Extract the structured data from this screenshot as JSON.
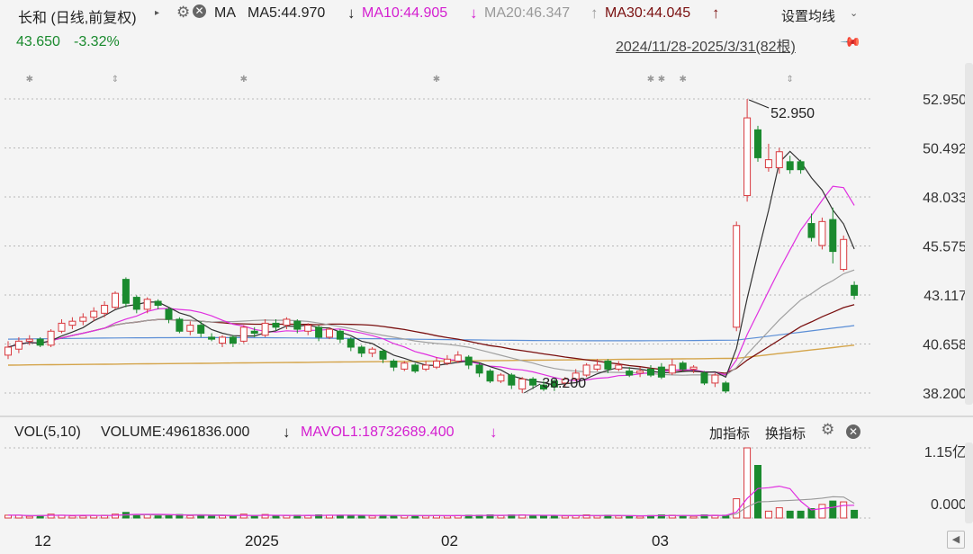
{
  "header": {
    "stock_title": "长和 (日线,前复权)",
    "ma_label": "MA",
    "ma5": "MA5:44.970",
    "ma5_arrow": "↓",
    "ma10": "MA10:44.905",
    "ma10_arrow": "↓",
    "ma20": "MA20:46.347",
    "ma20_arrow": "↑",
    "ma30": "MA30:44.045",
    "ma30_arrow": "↑",
    "settings_label": "设置均线",
    "price": "43.650",
    "change": "-3.32%",
    "date_range": "2024/11/28-2025/3/31(82根)"
  },
  "price_axis": [
    "52.950",
    "50.492",
    "48.033",
    "45.575",
    "43.117",
    "40.658",
    "38.200"
  ],
  "annotations": {
    "high": "52.950",
    "low": "38.200"
  },
  "volume": {
    "vol_label": "VOL(5,10)",
    "volume": "VOLUME:4961836.000",
    "volume_arrow": "↓",
    "mavol": "MAVOL1:18732689.400",
    "mavol_arrow": "↓",
    "add_indicator": "加指标",
    "switch_indicator": "换指标",
    "axis_top": "1.15亿",
    "axis_bottom": "0.000"
  },
  "x_axis": [
    "12",
    "2025",
    "02",
    "03"
  ],
  "colors": {
    "up": "#d8393e",
    "down": "#1a8a2e",
    "ma5": "#333333",
    "ma10": "#e02fe0",
    "ma20": "#a0a0a0",
    "ma30": "#7a1010",
    "ma60": "#5b8ed6",
    "ma120": "#d4a44a"
  },
  "chart_data": {
    "type": "candlestick",
    "ylim": [
      38.2,
      52.95
    ],
    "candles": [
      {
        "o": 40.1,
        "c": 40.5,
        "h": 40.8,
        "l": 39.9
      },
      {
        "o": 40.4,
        "c": 40.8,
        "h": 41.0,
        "l": 40.2
      },
      {
        "o": 40.8,
        "c": 40.9,
        "h": 41.1,
        "l": 40.6
      },
      {
        "o": 40.9,
        "c": 40.6,
        "h": 41.0,
        "l": 40.5
      },
      {
        "o": 40.6,
        "c": 41.3,
        "h": 41.4,
        "l": 40.5
      },
      {
        "o": 41.3,
        "c": 41.7,
        "h": 41.9,
        "l": 41.2
      },
      {
        "o": 41.6,
        "c": 41.8,
        "h": 42.0,
        "l": 41.4
      },
      {
        "o": 41.8,
        "c": 42.0,
        "h": 42.2,
        "l": 41.6
      },
      {
        "o": 42.0,
        "c": 42.3,
        "h": 42.5,
        "l": 41.8
      },
      {
        "o": 42.2,
        "c": 42.6,
        "h": 42.8,
        "l": 42.0
      },
      {
        "o": 42.5,
        "c": 43.2,
        "h": 43.3,
        "l": 42.4
      },
      {
        "o": 43.9,
        "c": 42.7,
        "h": 44.0,
        "l": 42.5
      },
      {
        "o": 43.0,
        "c": 42.4,
        "h": 43.1,
        "l": 42.2
      },
      {
        "o": 42.4,
        "c": 42.9,
        "h": 43.0,
        "l": 42.2
      },
      {
        "o": 42.8,
        "c": 42.6,
        "h": 42.9,
        "l": 42.4
      },
      {
        "o": 42.4,
        "c": 41.9,
        "h": 42.5,
        "l": 41.7
      },
      {
        "o": 41.9,
        "c": 41.3,
        "h": 42.0,
        "l": 41.2
      },
      {
        "o": 41.3,
        "c": 41.6,
        "h": 41.8,
        "l": 41.1
      },
      {
        "o": 41.6,
        "c": 41.2,
        "h": 41.8,
        "l": 41.0
      },
      {
        "o": 41.0,
        "c": 40.9,
        "h": 41.2,
        "l": 40.8
      },
      {
        "o": 40.7,
        "c": 41.0,
        "h": 41.1,
        "l": 40.5
      },
      {
        "o": 41.0,
        "c": 40.7,
        "h": 41.1,
        "l": 40.5
      },
      {
        "o": 40.8,
        "c": 41.5,
        "h": 41.6,
        "l": 40.7
      },
      {
        "o": 41.3,
        "c": 41.2,
        "h": 41.5,
        "l": 41.0
      },
      {
        "o": 41.1,
        "c": 41.7,
        "h": 41.9,
        "l": 41.0
      },
      {
        "o": 41.7,
        "c": 41.5,
        "h": 41.9,
        "l": 41.3
      },
      {
        "o": 41.6,
        "c": 41.9,
        "h": 42.0,
        "l": 41.4
      },
      {
        "o": 41.8,
        "c": 41.4,
        "h": 41.9,
        "l": 41.2
      },
      {
        "o": 41.3,
        "c": 41.6,
        "h": 41.7,
        "l": 41.1
      },
      {
        "o": 41.5,
        "c": 41.0,
        "h": 41.6,
        "l": 40.8
      },
      {
        "o": 41.0,
        "c": 41.4,
        "h": 41.5,
        "l": 40.9
      },
      {
        "o": 41.3,
        "c": 40.9,
        "h": 41.4,
        "l": 40.7
      },
      {
        "o": 40.9,
        "c": 40.5,
        "h": 41.0,
        "l": 40.3
      },
      {
        "o": 40.5,
        "c": 40.2,
        "h": 40.6,
        "l": 40.0
      },
      {
        "o": 40.2,
        "c": 40.4,
        "h": 40.5,
        "l": 40.0
      },
      {
        "o": 40.3,
        "c": 39.9,
        "h": 40.4,
        "l": 39.7
      },
      {
        "o": 39.8,
        "c": 39.5,
        "h": 39.9,
        "l": 39.3
      },
      {
        "o": 39.4,
        "c": 39.7,
        "h": 39.8,
        "l": 39.3
      },
      {
        "o": 39.6,
        "c": 39.3,
        "h": 39.7,
        "l": 39.2
      },
      {
        "o": 39.4,
        "c": 39.6,
        "h": 39.8,
        "l": 39.3
      },
      {
        "o": 39.5,
        "c": 39.8,
        "h": 40.0,
        "l": 39.4
      },
      {
        "o": 39.7,
        "c": 39.9,
        "h": 40.1,
        "l": 39.6
      },
      {
        "o": 39.8,
        "c": 40.1,
        "h": 40.3,
        "l": 39.7
      },
      {
        "o": 40.0,
        "c": 39.6,
        "h": 40.1,
        "l": 39.4
      },
      {
        "o": 39.6,
        "c": 39.2,
        "h": 39.7,
        "l": 39.0
      },
      {
        "o": 39.3,
        "c": 38.8,
        "h": 39.4,
        "l": 38.7
      },
      {
        "o": 38.8,
        "c": 39.1,
        "h": 39.2,
        "l": 38.7
      },
      {
        "o": 39.1,
        "c": 38.6,
        "h": 39.2,
        "l": 38.4
      },
      {
        "o": 38.4,
        "c": 38.9,
        "h": 39.0,
        "l": 38.2
      },
      {
        "o": 38.9,
        "c": 38.6,
        "h": 39.0,
        "l": 38.4
      },
      {
        "o": 38.6,
        "c": 38.4,
        "h": 38.8,
        "l": 38.3
      },
      {
        "o": 38.8,
        "c": 38.5,
        "h": 38.9,
        "l": 38.3
      },
      {
        "o": 38.7,
        "c": 38.9,
        "h": 39.0,
        "l": 38.5
      },
      {
        "o": 38.9,
        "c": 39.2,
        "h": 39.4,
        "l": 38.8
      },
      {
        "o": 39.1,
        "c": 39.6,
        "h": 39.7,
        "l": 39.0
      },
      {
        "o": 39.4,
        "c": 39.6,
        "h": 39.9,
        "l": 39.3
      },
      {
        "o": 39.8,
        "c": 39.4,
        "h": 39.9,
        "l": 39.2
      },
      {
        "o": 39.4,
        "c": 39.6,
        "h": 39.8,
        "l": 39.3
      },
      {
        "o": 39.3,
        "c": 39.1,
        "h": 39.5,
        "l": 39.0
      },
      {
        "o": 39.2,
        "c": 39.3,
        "h": 39.5,
        "l": 39.0
      },
      {
        "o": 39.4,
        "c": 39.1,
        "h": 39.6,
        "l": 39.0
      },
      {
        "o": 39.5,
        "c": 39.0,
        "h": 39.7,
        "l": 38.9
      },
      {
        "o": 39.2,
        "c": 39.6,
        "h": 39.9,
        "l": 39.1
      },
      {
        "o": 39.7,
        "c": 39.4,
        "h": 39.8,
        "l": 39.3
      },
      {
        "o": 39.4,
        "c": 39.5,
        "h": 39.6,
        "l": 39.2
      },
      {
        "o": 39.2,
        "c": 38.7,
        "h": 39.3,
        "l": 38.6
      },
      {
        "o": 38.7,
        "c": 39.1,
        "h": 39.2,
        "l": 38.5
      },
      {
        "o": 38.7,
        "c": 38.3,
        "h": 38.8,
        "l": 38.2
      },
      {
        "o": 41.5,
        "c": 46.6,
        "h": 46.8,
        "l": 41.3
      },
      {
        "o": 48.1,
        "c": 52.0,
        "h": 52.95,
        "l": 47.8
      },
      {
        "o": 51.4,
        "c": 50.0,
        "h": 51.6,
        "l": 49.8
      },
      {
        "o": 49.5,
        "c": 49.9,
        "h": 50.7,
        "l": 49.3
      },
      {
        "o": 49.5,
        "c": 50.3,
        "h": 50.5,
        "l": 49.2
      },
      {
        "o": 49.8,
        "c": 49.4,
        "h": 50.1,
        "l": 49.2
      },
      {
        "o": 49.8,
        "c": 49.4,
        "h": 49.9,
        "l": 49.2
      },
      {
        "o": 46.7,
        "c": 46.0,
        "h": 47.2,
        "l": 45.8
      },
      {
        "o": 45.6,
        "c": 46.8,
        "h": 47.0,
        "l": 45.4
      },
      {
        "o": 46.9,
        "c": 45.3,
        "h": 47.5,
        "l": 44.7
      },
      {
        "o": 44.4,
        "c": 45.9,
        "h": 46.1,
        "l": 44.3
      },
      {
        "o": 43.6,
        "c": 43.1,
        "h": 43.8,
        "l": 42.9
      }
    ],
    "x_ticks": [
      "12",
      "2025",
      "02",
      "03"
    ],
    "volume_ylim": [
      0,
      1.15
    ],
    "volume_unit": "亿"
  }
}
